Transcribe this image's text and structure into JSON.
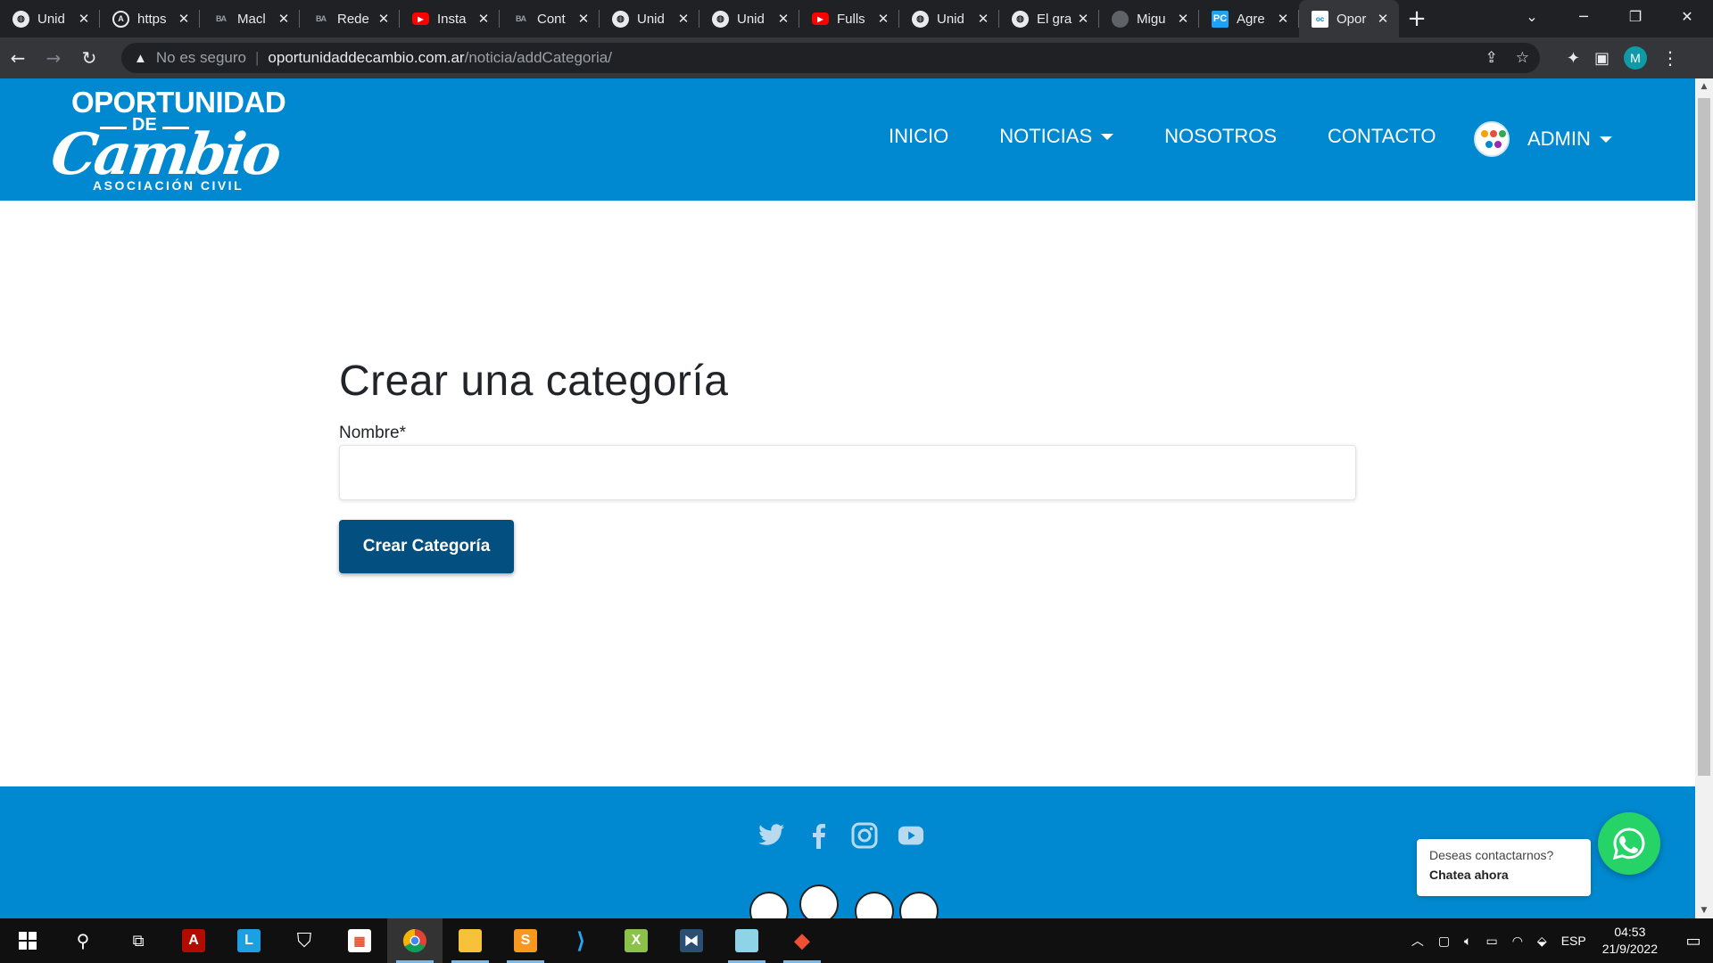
{
  "browser": {
    "tabs": [
      {
        "title": "Unid",
        "icon": "globe-icon"
      },
      {
        "title": "https",
        "icon": "angular-icon"
      },
      {
        "title": "Macl",
        "icon": "ba-icon"
      },
      {
        "title": "Rede",
        "icon": "ba-icon"
      },
      {
        "title": "Insta",
        "icon": "youtube-icon"
      },
      {
        "title": "Cont",
        "icon": "ba-icon"
      },
      {
        "title": "Unid",
        "icon": "globe-icon"
      },
      {
        "title": "Unid",
        "icon": "globe-icon"
      },
      {
        "title": "Fulls",
        "icon": "youtube-icon"
      },
      {
        "title": "Unid",
        "icon": "globe-icon"
      },
      {
        "title": "El gra",
        "icon": "globe-icon"
      },
      {
        "title": "Migu",
        "icon": "github-icon"
      },
      {
        "title": "Agre",
        "icon": "pycharm-icon"
      },
      {
        "title": "Opor",
        "icon": "site-icon",
        "active": true
      }
    ],
    "new_tab": "+",
    "security_label": "No es seguro",
    "url_host": "oportunidaddecambio.com.ar",
    "url_path": "/noticia/addCategoria/",
    "profile_initial": "M"
  },
  "site": {
    "logo": {
      "line1": "OPORTUNIDAD",
      "line2": "DE",
      "line3": "Cambio",
      "line4": "ASOCIACIÓN CIVIL"
    },
    "nav": {
      "inicio": "INICIO",
      "noticias": "NOTICIAS",
      "nosotros": "NOSOTROS",
      "contacto": "CONTACTO",
      "user": "ADMIN"
    }
  },
  "form": {
    "title": "Crear una categoría",
    "name_label": "Nombre*",
    "name_value": "",
    "submit_label": "Crear Categoría"
  },
  "whatsapp": {
    "question": "Deseas contactarnos?",
    "cta": "Chatea ahora"
  },
  "taskbar": {
    "language": "ESP",
    "time": "04:53",
    "date": "21/9/2022"
  },
  "colors": {
    "brand_blue": "#0089d0",
    "button_dark_blue": "#034f7f",
    "whatsapp_green": "#25d366"
  }
}
